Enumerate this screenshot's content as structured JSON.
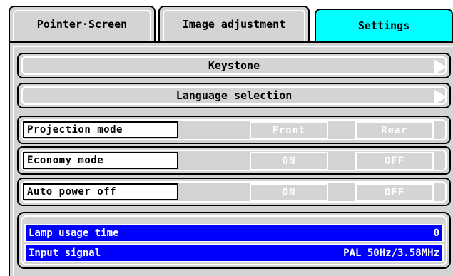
{
  "tabs": [
    {
      "label": "Pointer·Screen",
      "active": false
    },
    {
      "label": "Image adjustment",
      "active": false
    },
    {
      "label": "Settings",
      "active": true
    }
  ],
  "menu": {
    "keystone_label": "Keystone",
    "language_label": "Language selection"
  },
  "options": {
    "projection": {
      "label": "Projection mode",
      "opt1": "Front",
      "opt2": "Rear"
    },
    "economy": {
      "label": "Economy mode",
      "opt1": "ON",
      "opt2": "OFF"
    },
    "autopower": {
      "label": "Auto power off",
      "opt1": "ON",
      "opt2": "OFF"
    }
  },
  "info": {
    "lamp_label": "Lamp usage time",
    "lamp_value": "0",
    "signal_label": "Input signal",
    "signal_value": "PAL 50Hz/3.58MHz"
  },
  "colors": {
    "panel": "#d4d4d4",
    "active_tab": "#00ffff",
    "info_bg": "#0000ff"
  },
  "icons": [
    "right-triangle-arrow-icon"
  ]
}
